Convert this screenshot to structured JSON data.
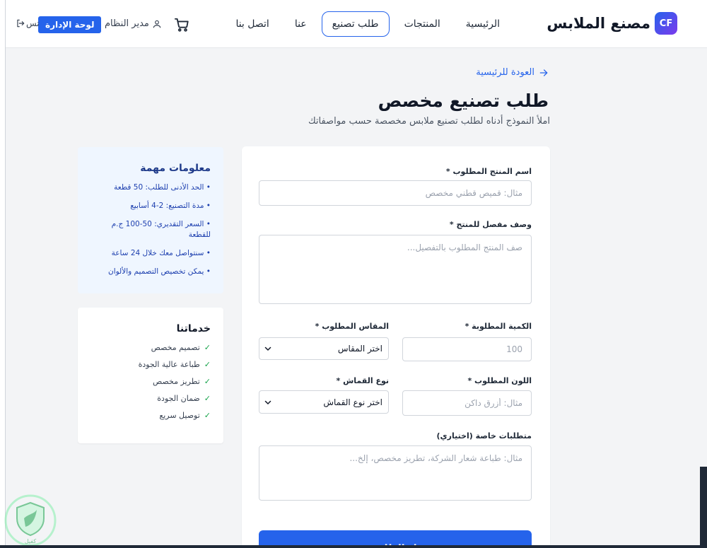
{
  "header": {
    "brand_logo": "CF",
    "brand_name": "مصنع الملابس",
    "nav": [
      "الرئيسية",
      "المنتجات",
      "طلب تصنيع",
      "عنا",
      "اتصل بنا"
    ],
    "active_nav": "طلب تصنيع",
    "user_name": "مدير النظام",
    "admin_button": "لوحة الإدارة",
    "logout_partial": "تس"
  },
  "page": {
    "back_link": "العودة للرئيسية",
    "title": "طلب تصنيع مخصص",
    "subtitle": "املأ النموذج أدناه لطلب تصنيع ملابس مخصصة حسب مواصفاتك"
  },
  "form": {
    "product_name": {
      "label": "اسم المنتج المطلوب *",
      "placeholder": "مثال: قميص قطني مخصص"
    },
    "description": {
      "label": "وصف مفصل للمنتج *",
      "placeholder": "صف المنتج المطلوب بالتفصيل..."
    },
    "quantity": {
      "label": "الكمية المطلوبة *",
      "placeholder": "100"
    },
    "size": {
      "label": "المقاس المطلوب *",
      "selected": "اختر المقاس"
    },
    "color": {
      "label": "اللون المطلوب *",
      "placeholder": "مثال: أزرق داكن"
    },
    "fabric": {
      "label": "نوع القماش *",
      "selected": "اختر نوع القماش"
    },
    "special": {
      "label": "متطلبات خاصة (اختياري)",
      "placeholder": "مثال: طباعة شعار الشركة، تطريز مخصص، إلخ..."
    },
    "submit_partial": "ل الطلب"
  },
  "info_card": {
    "title": "معلومات مهمة",
    "items": [
      "• الحد الأدنى للطلب: 50 قطعة",
      "• مدة التصنيع: 2-4 أسابيع",
      "• السعر التقديري: 50-100 ج.م للقطعة",
      "• سنتواصل معك خلال 24 ساعة",
      "• يمكن تخصيص التصميم والألوان"
    ]
  },
  "services_card": {
    "title": "خدماتنا",
    "check_glyph": "✓",
    "items": [
      "تصميم مخصص",
      "طباعة عالية الجودة",
      "تطريز مخصص",
      "ضمان الجودة",
      "توصيل سريع"
    ]
  },
  "watermark_text": "كفيل",
  "colors": {
    "primary": "#2563eb",
    "info_bg": "#eff6ff",
    "check": "#16a34a"
  }
}
